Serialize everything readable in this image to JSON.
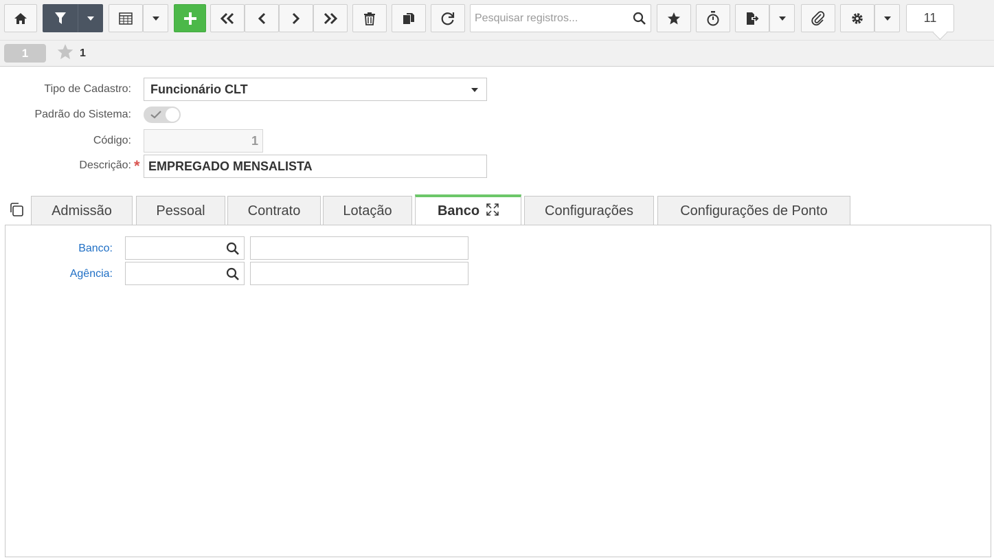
{
  "toolbar": {
    "search_placeholder": "Pesquisar registros...",
    "counter": "11",
    "icons": {
      "home": "home-icon",
      "filter": "filter-icon",
      "grid": "table-icon",
      "add": "plus-icon",
      "first": "double-chevron-left-icon",
      "prev": "chevron-left-icon",
      "next": "chevron-right-icon",
      "last": "double-chevron-right-icon",
      "delete": "trash-icon",
      "duplicate": "copy-icon",
      "refresh": "refresh-icon",
      "search": "search-icon",
      "favorite": "star-icon",
      "timer": "stopwatch-icon",
      "export": "export-icon",
      "attach": "paperclip-icon",
      "settings": "gear-icon"
    }
  },
  "record_bar": {
    "record_pill": "1",
    "favorites_count": "1"
  },
  "form": {
    "tipo_label": "Tipo de Cadastro:",
    "tipo_value": "Funcionário CLT",
    "padrao_label": "Padrão do Sistema:",
    "padrao_checked": true,
    "codigo_label": "Código:",
    "codigo_value": "1",
    "descricao_label": "Descrição:",
    "descricao_required": "*",
    "descricao_value": "EMPREGADO MENSALISTA"
  },
  "tabs": [
    {
      "label": "Admissão"
    },
    {
      "label": "Pessoal"
    },
    {
      "label": "Contrato"
    },
    {
      "label": "Lotação"
    },
    {
      "label": "Banco",
      "active": true
    },
    {
      "label": "Configurações"
    },
    {
      "label": "Configurações de Ponto"
    }
  ],
  "banco_tab": {
    "banco_label": "Banco:",
    "agencia_label": "Agência:"
  },
  "colors": {
    "accent_green": "#4cb849",
    "active_tab_border": "#6cc769",
    "link_blue": "#1f6fc5",
    "required_red": "#d9534f",
    "dark_button": "#4b5562"
  }
}
